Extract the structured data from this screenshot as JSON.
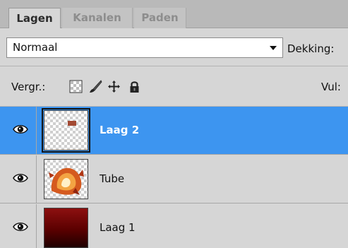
{
  "tabs": [
    {
      "label": "Lagen"
    },
    {
      "label": "Kanalen"
    },
    {
      "label": "Paden"
    }
  ],
  "blend": {
    "mode": "Normaal",
    "opacity_label": "Dekking:"
  },
  "lock": {
    "label": "Vergr.:",
    "fill_label": "Vul:",
    "icons": [
      "lock-transparent-pixels-icon",
      "lock-image-pixels-icon",
      "lock-position-icon",
      "lock-all-icon"
    ]
  },
  "layers": [
    {
      "name": "Laag 2",
      "selected": true,
      "visible": true
    },
    {
      "name": "Tube",
      "selected": false,
      "visible": true
    },
    {
      "name": "Laag 1",
      "selected": false,
      "visible": true
    }
  ],
  "colors": {
    "selection": "#3d95f0",
    "panel": "#d6d6d6",
    "layer1_fill": "#7a0a0a"
  }
}
